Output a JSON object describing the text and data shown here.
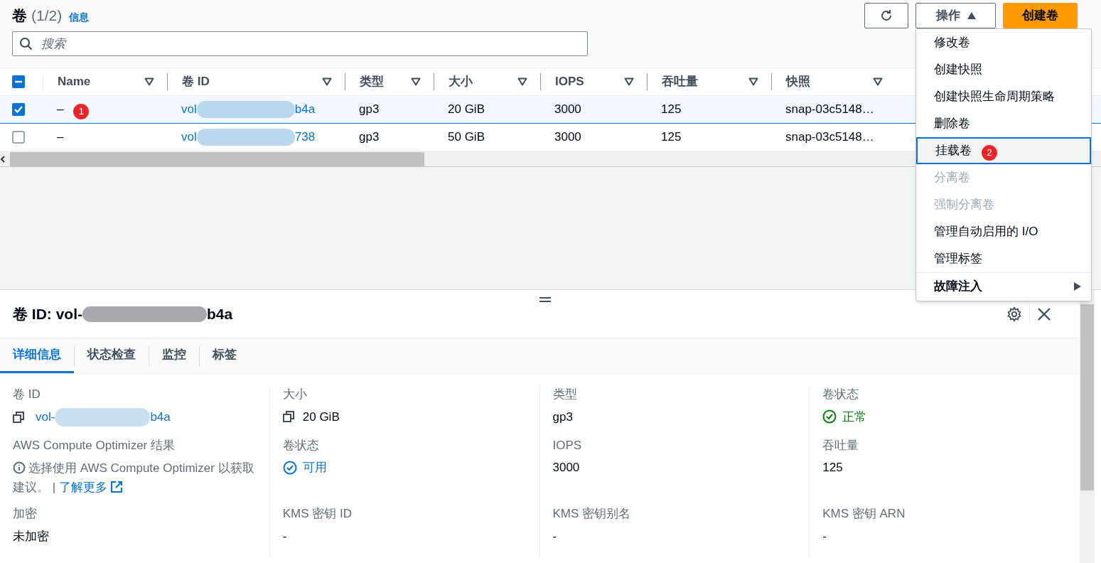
{
  "header": {
    "title": "卷",
    "count": "(1/2)",
    "info_link": "信息"
  },
  "search": {
    "placeholder": "搜索"
  },
  "buttons": {
    "actions": "操作",
    "create": "创建卷"
  },
  "table": {
    "select_all": {
      "partial": true
    },
    "columns": [
      {
        "label": "Name",
        "filter": true
      },
      {
        "label": "卷 ID",
        "filter": true
      },
      {
        "label": "类型",
        "filter": true
      },
      {
        "label": "大小",
        "filter": true
      },
      {
        "label": "IOPS",
        "filter": true
      },
      {
        "label": "吞吐量",
        "filter": true
      },
      {
        "label": "快照",
        "filter": true
      }
    ],
    "rows": [
      {
        "selected": true,
        "checked": true,
        "name": "–",
        "annotation": "1",
        "volume_id_start": "vol",
        "volume_id_end": "b4a",
        "type": "gp3",
        "size": "20 GiB",
        "iops": "3000",
        "throughput": "125",
        "snapshot": "snap-03c5148…"
      },
      {
        "selected": false,
        "checked": false,
        "name": "–",
        "volume_id_start": "vol",
        "volume_id_end": "738",
        "type": "gp3",
        "size": "50 GiB",
        "iops": "3000",
        "throughput": "125",
        "snapshot": "snap-03c5148…"
      }
    ]
  },
  "menu": {
    "items": [
      {
        "label": "修改卷",
        "kind": "item",
        "disabled": false,
        "selected": false
      },
      {
        "label": "创建快照",
        "kind": "item",
        "disabled": false,
        "selected": false
      },
      {
        "label": "创建快照生命周期策略",
        "kind": "item",
        "disabled": false,
        "selected": false
      },
      {
        "label": "删除卷",
        "kind": "item",
        "disabled": false,
        "selected": false
      },
      {
        "label": "挂载卷",
        "kind": "item",
        "disabled": false,
        "selected": true,
        "annotation": "2"
      },
      {
        "label": "分离卷",
        "kind": "item",
        "disabled": true,
        "selected": false
      },
      {
        "label": "强制分离卷",
        "kind": "item",
        "disabled": true,
        "selected": false
      },
      {
        "label": "管理自动启用的 I/O",
        "kind": "item",
        "disabled": false,
        "selected": false
      },
      {
        "label": "管理标签",
        "kind": "item",
        "disabled": false,
        "selected": false
      },
      {
        "label": "故障注入",
        "kind": "submenu",
        "disabled": false,
        "selected": false
      }
    ]
  },
  "detail": {
    "title_start": "卷 ID: vol-",
    "title_end": "b4a",
    "tabs": [
      {
        "label": "详细信息",
        "selected": true
      },
      {
        "label": "状态检查",
        "selected": false
      },
      {
        "label": "监控",
        "selected": false
      },
      {
        "label": "标签",
        "selected": false
      }
    ],
    "columns": [
      [
        {
          "label": "卷 ID",
          "kind": "redacted-link",
          "value_start": "vol-",
          "value_end": "b4a"
        },
        {
          "label": "AWS Compute Optimizer 结果",
          "kind": "note",
          "value": "选择使用 AWS Compute Optimizer 以获取建议。 |",
          "link": "了解更多"
        },
        {
          "label": "加密",
          "kind": "text",
          "value": "未加密"
        }
      ],
      [
        {
          "label": "大小",
          "kind": "copy",
          "value": "20 GiB"
        },
        {
          "label": "卷状态",
          "kind": "status",
          "value": "可用",
          "color": "#0972d3"
        },
        {
          "label": "KMS 密钥 ID",
          "kind": "text",
          "value": "-"
        }
      ],
      [
        {
          "label": "类型",
          "kind": "text",
          "value": "gp3"
        },
        {
          "label": "IOPS",
          "kind": "text",
          "value": "3000"
        },
        {
          "label": "KMS 密钥别名",
          "kind": "text",
          "value": "-"
        }
      ],
      [
        {
          "label": "卷状态",
          "kind": "status",
          "value": "正常",
          "color": "#037f0c"
        },
        {
          "label": "吞吐量",
          "kind": "text",
          "value": "125"
        },
        {
          "label": "KMS 密钥 ARN",
          "kind": "text",
          "value": "-"
        }
      ]
    ]
  }
}
